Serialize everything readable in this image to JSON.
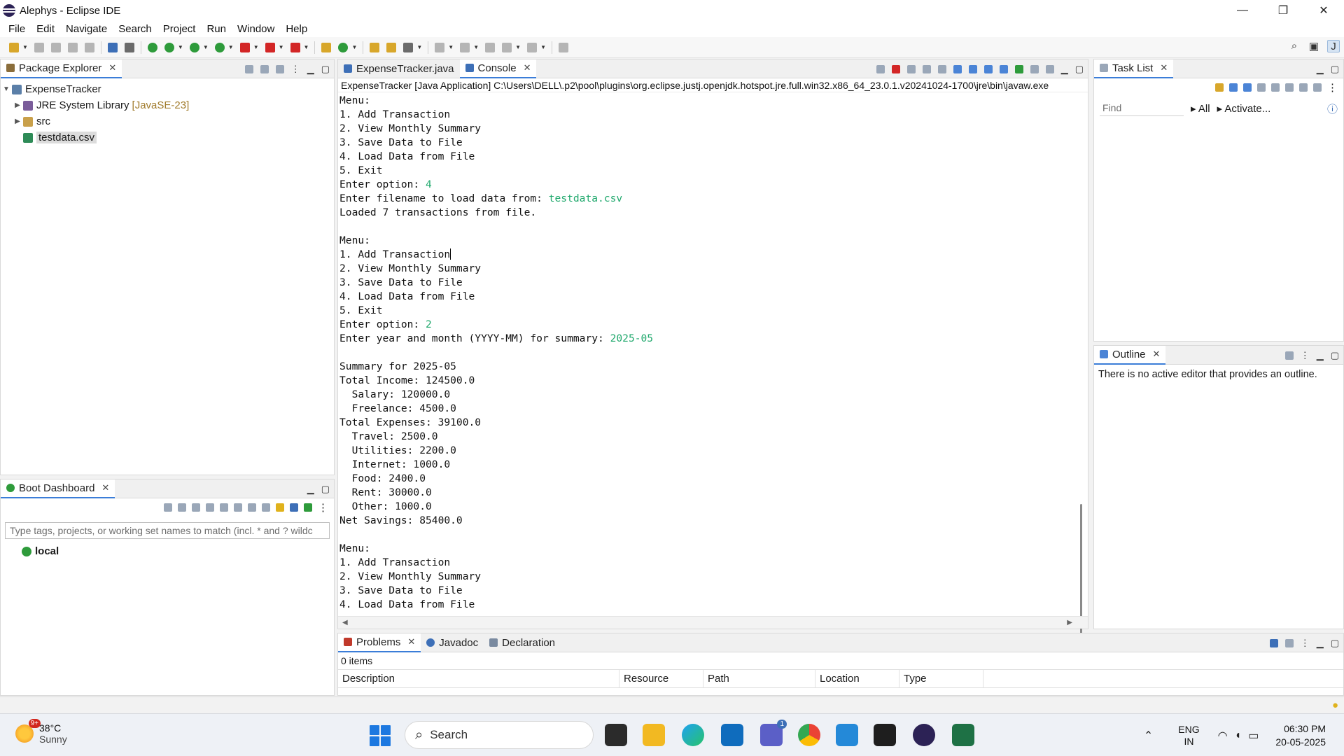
{
  "window": {
    "title": "Alephys - Eclipse IDE",
    "minimize": "—",
    "restore": "❐",
    "close": "✕"
  },
  "menu": [
    "File",
    "Edit",
    "Navigate",
    "Search",
    "Project",
    "Run",
    "Window",
    "Help"
  ],
  "package_explorer": {
    "tab": "Package Explorer",
    "project": "ExpenseTracker",
    "jre": "JRE System Library",
    "jre_version": "[JavaSE-23]",
    "src": "src",
    "file": "testdata.csv"
  },
  "boot_dashboard": {
    "tab": "Boot Dashboard",
    "filter_placeholder": "Type tags, projects, or working set names to match (incl. * and ? wildc",
    "local": "local"
  },
  "editor_tabs": {
    "java_file": "ExpenseTracker.java",
    "console": "Console"
  },
  "console": {
    "header": "ExpenseTracker [Java Application] C:\\Users\\DELL\\.p2\\pool\\plugins\\org.eclipse.justj.openjdk.hotspot.jre.full.win32.x86_64_23.0.1.v20241024-1700\\jre\\bin\\javaw.exe",
    "menu_title": "Menu:",
    "opt1": "1. Add Transaction",
    "opt2": "2. View Monthly Summary",
    "opt3": "3. Save Data to File",
    "opt4": "4. Load Data from File",
    "opt5": "5. Exit",
    "enter_option": "Enter option: ",
    "input_option_1": "4",
    "enter_filename": "Enter filename to load data from: ",
    "input_filename": "testdata.csv",
    "loaded": "Loaded 7 transactions from file.",
    "input_option_2": "2",
    "enter_month": "Enter year and month (YYYY-MM) for summary: ",
    "input_month": "2025-05",
    "summary_for": "Summary for 2025-05",
    "total_income": "Total Income: 124500.0",
    "salary": "  Salary: 120000.0",
    "freelance": "  Freelance: 4500.0",
    "total_expenses": "Total Expenses: 39100.0",
    "travel": "  Travel: 2500.0",
    "utilities": "  Utilities: 2200.0",
    "internet": "  Internet: 1000.0",
    "food": "  Food: 2400.0",
    "rent": "  Rent: 30000.0",
    "other": "  Other: 1000.0",
    "net_savings": "Net Savings: 85400.0"
  },
  "task_list": {
    "tab": "Task List",
    "find_placeholder": "Find",
    "all": "All",
    "activate": "Activate..."
  },
  "outline": {
    "tab": "Outline",
    "message": "There is no active editor that provides an outline."
  },
  "problems": {
    "tab": "Problems",
    "javadoc": "Javadoc",
    "declaration": "Declaration",
    "count": "0 items",
    "columns": [
      "Description",
      "Resource",
      "Path",
      "Location",
      "Type"
    ]
  },
  "taskbar": {
    "weather_temp": "38°C",
    "weather_desc": "Sunny",
    "weather_badge": "9+",
    "search": "Search",
    "lang1": "ENG",
    "lang2": "IN",
    "time": "06:30 PM",
    "date": "20-05-2025",
    "teams_badge": "1"
  }
}
